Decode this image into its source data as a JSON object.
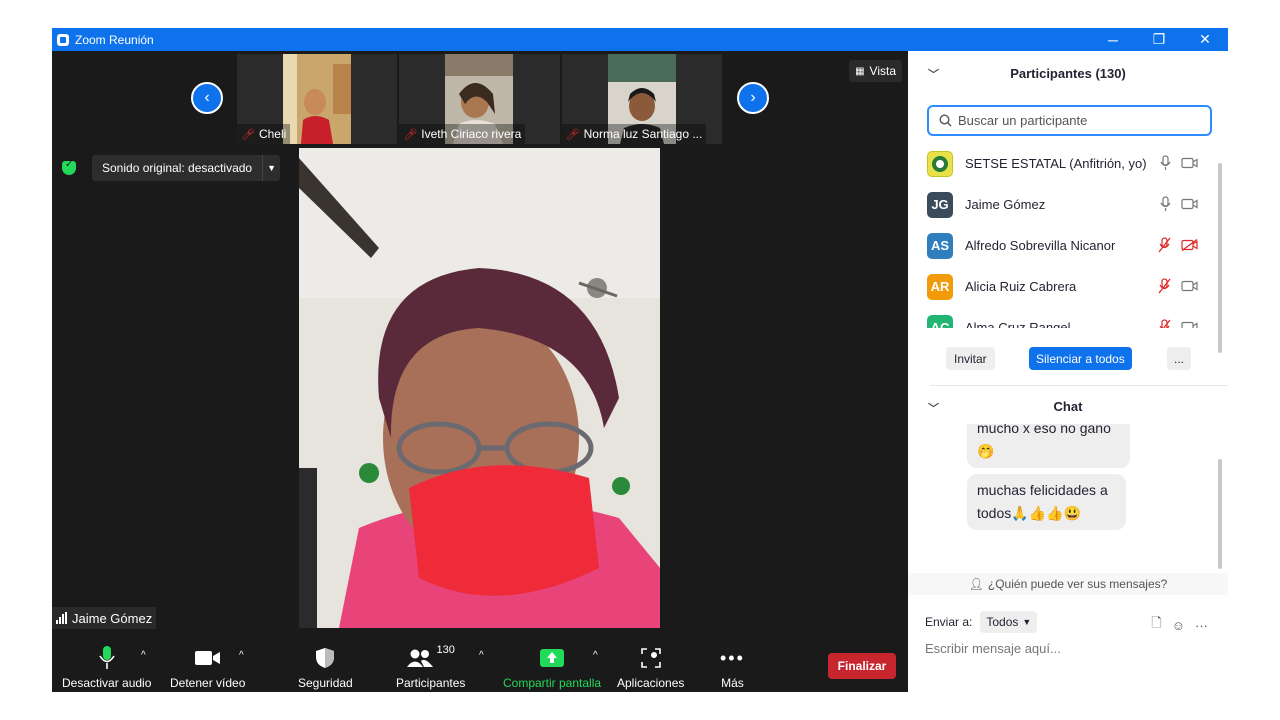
{
  "window": {
    "title": "Zoom Reunión"
  },
  "stage": {
    "vista_label": "Vista",
    "sound_original": "Sonido original: desactivado",
    "thumbnails": [
      {
        "name": "Cheli"
      },
      {
        "name": "Iveth Ciriaco rivera"
      },
      {
        "name": "Norma luz Santiago ..."
      }
    ],
    "active_speaker": "Jaime Gómez"
  },
  "toolbar": {
    "mute_label": "Desactivar audio",
    "video_label": "Detener vídeo",
    "security_label": "Seguridad",
    "participants_label": "Participantes",
    "participants_count": "130",
    "share_label": "Compartir pantalla",
    "apps_label": "Aplicaciones",
    "more_label": "Más",
    "end_label": "Finalizar"
  },
  "participants_panel": {
    "title": "Participantes (130)",
    "search_placeholder": "Buscar un participante",
    "list": [
      {
        "initials": "",
        "name": "SETSE ESTATAL (Anfitrión, yo)",
        "avatar_color": "#e8e24a",
        "audio": "on",
        "video": "off"
      },
      {
        "initials": "JG",
        "name": "Jaime Gómez",
        "avatar_color": "#3a4b5c",
        "audio": "on",
        "video": "off"
      },
      {
        "initials": "AS",
        "name": "Alfredo Sobrevilla Nicanor",
        "avatar_color": "#2f7fbf",
        "audio": "muted",
        "video": "muted"
      },
      {
        "initials": "AR",
        "name": "Alicia Ruiz Cabrera",
        "avatar_color": "#f29b0a",
        "audio": "muted",
        "video": "off"
      },
      {
        "initials": "AC",
        "name": "Alma Cruz Rangel",
        "avatar_color": "#22b573",
        "audio": "muted",
        "video": "off"
      }
    ],
    "invite_label": "Invitar",
    "mute_all_label": "Silenciar a todos",
    "more_label": "..."
  },
  "chat_panel": {
    "title": "Chat",
    "messages": [
      {
        "text": "mucho x eso no gano 🤭"
      },
      {
        "text": "muchas felicidades a todos🙏👍👍😃"
      }
    ],
    "who_sees": "¿Quién puede ver sus mensajes?",
    "send_to_label": "Enviar a:",
    "send_to_value": "Todos",
    "input_placeholder": "Escribir mensaje aquí..."
  },
  "colors": {
    "accent": "#0e72ed",
    "end": "#c7262f",
    "share_green": "#23d959",
    "muted_red": "#e02828"
  }
}
